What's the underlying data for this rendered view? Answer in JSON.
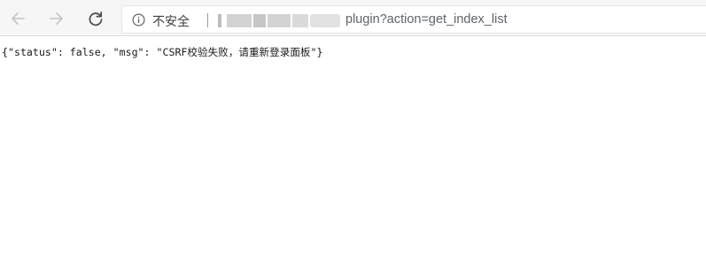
{
  "toolbar": {
    "back_icon": "arrow-left-icon",
    "forward_icon": "arrow-right-icon",
    "reload_icon": "reload-icon",
    "address_bar": {
      "security_icon": "info-circle-icon",
      "security_label": "不安全",
      "url_visible": "plugin?action=get_index_list"
    }
  },
  "page": {
    "response_text": "{\"status\": false, \"msg\": \"CSRF校验失败，请重新登录面板\"}"
  }
}
